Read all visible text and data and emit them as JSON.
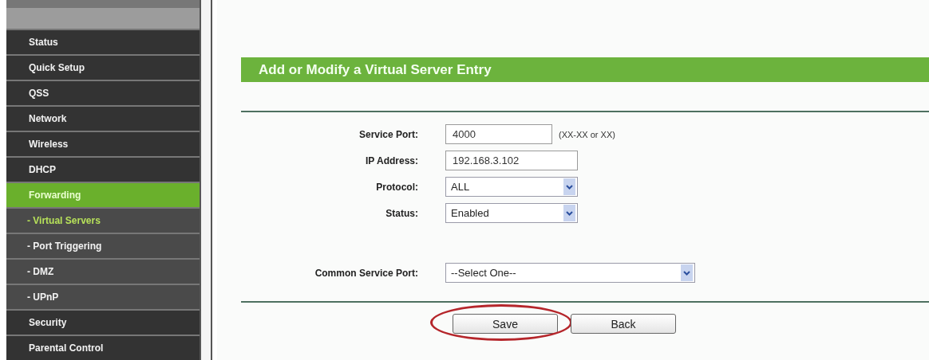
{
  "sidebar": {
    "items": [
      {
        "label": "Status",
        "kind": "main",
        "selected": false
      },
      {
        "label": "Quick Setup",
        "kind": "main",
        "selected": false
      },
      {
        "label": "QSS",
        "kind": "main",
        "selected": false
      },
      {
        "label": "Network",
        "kind": "main",
        "selected": false
      },
      {
        "label": "Wireless",
        "kind": "main",
        "selected": false
      },
      {
        "label": "DHCP",
        "kind": "main",
        "selected": false
      },
      {
        "label": "Forwarding",
        "kind": "main",
        "selected": true
      },
      {
        "label": "- Virtual Servers",
        "kind": "sub",
        "selected": true
      },
      {
        "label": "- Port Triggering",
        "kind": "sub",
        "selected": false
      },
      {
        "label": "- DMZ",
        "kind": "sub",
        "selected": false
      },
      {
        "label": "- UPnP",
        "kind": "sub",
        "selected": false
      },
      {
        "label": "Security",
        "kind": "main",
        "selected": false
      },
      {
        "label": "Parental Control",
        "kind": "main",
        "selected": false
      }
    ]
  },
  "panel": {
    "title": "Add or Modify a Virtual Server Entry",
    "fields": [
      {
        "label": "Service Port:",
        "kind": "text",
        "value": "4000",
        "hint": "(XX-XX or XX)"
      },
      {
        "label": "IP Address:",
        "kind": "text",
        "value": "192.168.3.102"
      },
      {
        "label": "Protocol:",
        "kind": "select",
        "value": "ALL"
      },
      {
        "label": "Status:",
        "kind": "select",
        "value": "Enabled"
      }
    ],
    "common_fields": [
      {
        "label": "Common Service Port:",
        "kind": "select",
        "value": "--Select One--"
      }
    ],
    "buttons": [
      {
        "label": "Save",
        "circled": true
      },
      {
        "label": "Back",
        "circled": false
      }
    ]
  }
}
